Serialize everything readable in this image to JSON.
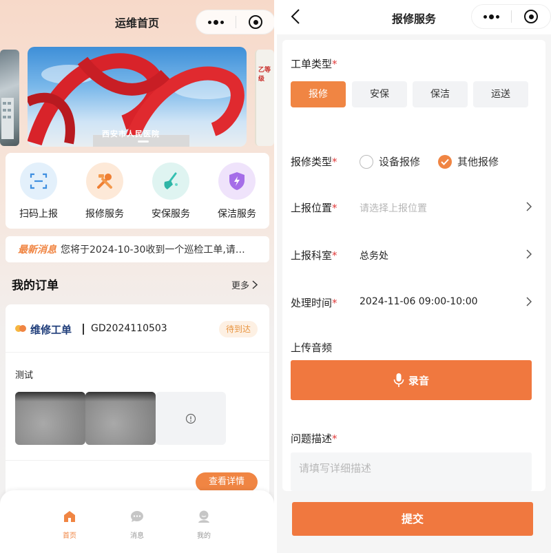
{
  "left": {
    "title": "运维首页",
    "banner_sign": "西安市人民医院",
    "banner_side_text": "乙等级",
    "quick_actions": [
      {
        "label": "扫码上报",
        "icon": "scan-icon"
      },
      {
        "label": "报修服务",
        "icon": "repair-tools-icon"
      },
      {
        "label": "安保服务",
        "icon": "broom-icon"
      },
      {
        "label": "保洁服务",
        "icon": "shield-icon"
      }
    ],
    "news": {
      "tag": "最新消息",
      "text": "您将于2024-10-30收到一个巡检工单,请…"
    },
    "orders": {
      "title": "我的订单",
      "more": "更多",
      "card": {
        "type": "维修工单",
        "id": "GD2024110503",
        "status": "待到达",
        "description": "测试",
        "detail_button": "查看详情"
      }
    },
    "tabbar": [
      {
        "label": "首页",
        "icon": "home-icon",
        "active": true
      },
      {
        "label": "消息",
        "icon": "message-icon",
        "active": false
      },
      {
        "label": "我的",
        "icon": "profile-icon",
        "active": false
      }
    ]
  },
  "right": {
    "title": "报修服务",
    "order_type": {
      "label": "工单类型",
      "options": [
        "报修",
        "安保",
        "保洁",
        "运送"
      ],
      "selected": "报修"
    },
    "repair_type": {
      "label": "报修类型",
      "options": [
        "设备报修",
        "其他报修"
      ],
      "selected": "其他报修"
    },
    "location": {
      "label": "上报位置",
      "placeholder": "请选择上报位置"
    },
    "department": {
      "label": "上报科室",
      "value": "总务处"
    },
    "time": {
      "label": "处理时间",
      "value": "2024-11-06 09:00-10:00"
    },
    "audio": {
      "label": "上传音频",
      "button": "录音"
    },
    "description": {
      "label": "问题描述",
      "placeholder": "请填写详细描述"
    },
    "submit": "提交",
    "required_mark": "*"
  },
  "colors": {
    "accent": "#f08543",
    "required": "#e03b3b",
    "order_type_text": "#1f3d7a"
  }
}
